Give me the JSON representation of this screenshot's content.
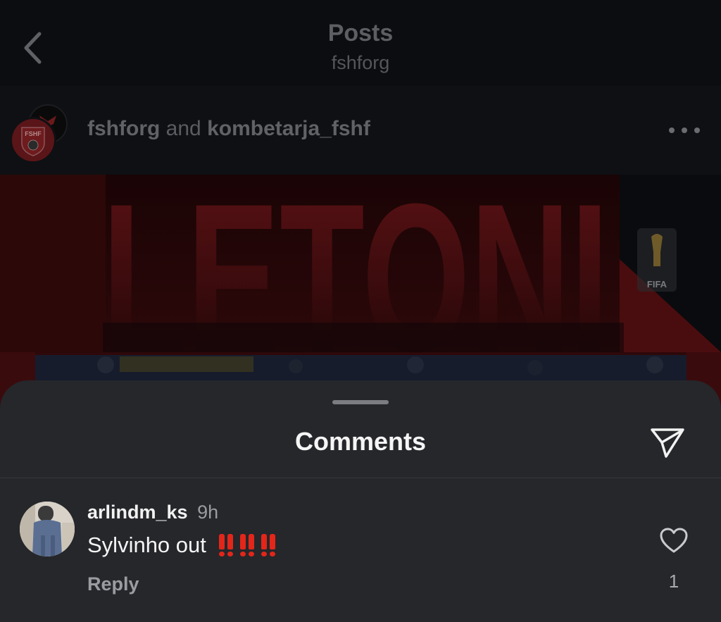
{
  "nav": {
    "title": "Posts",
    "subtitle": "fshforg",
    "back_icon": "chevron-left-icon"
  },
  "post": {
    "author_primary": "fshforg",
    "conjunction": "and",
    "author_secondary": "kombetarja_fshf",
    "avatar_badge_text": "FSHF",
    "more_icon": "ellipsis-icon",
    "image": {
      "headline": "LETONI",
      "badge_text": "FIFA"
    }
  },
  "comments_sheet": {
    "title": "Comments",
    "share_icon": "paper-plane-icon",
    "comments": [
      {
        "username": "arlindm_ks",
        "time": "9h",
        "text": "Sylvinho out",
        "emoji": "‼️ ‼️ ‼️",
        "reply_label": "Reply",
        "like_count": "1",
        "like_icon": "heart-outline-icon"
      }
    ]
  },
  "colors": {
    "sheet_background": "#25272b",
    "accent_red": "#e3261a",
    "background": "#0b0c0f"
  }
}
